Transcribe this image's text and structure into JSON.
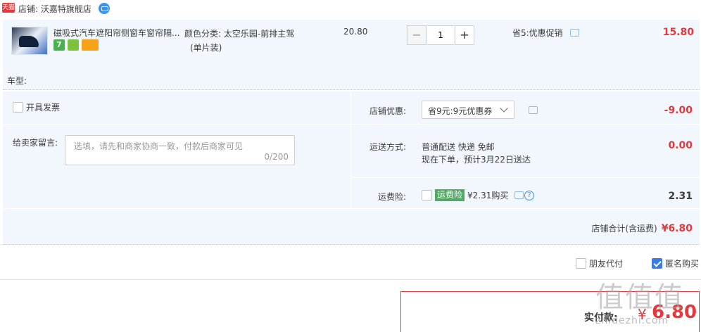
{
  "shop": {
    "badge": "天猫",
    "label": "店铺: 沃嘉特旗舰店"
  },
  "item": {
    "title": "磁吸式汽车遮阳帘侧窗车窗帘隔...",
    "badge_7": "7",
    "sku_label": "颜色分类:",
    "sku_value": "太空乐园-前排主驾",
    "sku_extra": "(单片装)",
    "unit_price": "20.80",
    "quantity": "1",
    "qty_minus": "−",
    "qty_plus": "+",
    "promo": "省5:优惠促销",
    "total": "15.80",
    "car_type_label": "车型:"
  },
  "options": {
    "invoice_label": "开具发票",
    "message_label": "给卖家留言:",
    "message_placeholder": "选填，请先和商家协商一致，付款后商家可见",
    "message_count": "0/200",
    "coupon_label": "店铺优惠:",
    "coupon_selected": "省9元:9元优惠券",
    "coupon_value": "-9.00",
    "shipping_label": "运送方式:",
    "shipping_line1": "普通配送 快递 免邮",
    "shipping_line2": "现在下单，预计3月22日送达",
    "shipping_value": "0.00",
    "insurance_label": "运费险:",
    "insurance_tag": "运费险",
    "insurance_price": "¥2.31购买",
    "insurance_value": "2.31",
    "help_glyph": "?",
    "shop_total_label": "店铺合计(含运费)",
    "shop_total_value": "¥6.80"
  },
  "payment": {
    "friend_pay": "朋友代付",
    "anonymous": "匿名购买",
    "actual_label": "实付款:",
    "currency": "¥",
    "amount": "6.80"
  },
  "watermark": {
    "main": "值值值",
    "sub": "zhidezhi.com"
  },
  "colors": {
    "accent_red": "#e4393c",
    "panel_bg": "#f2f7fe",
    "insurance_green": "#53a964",
    "check_blue": "#3a7de0"
  }
}
